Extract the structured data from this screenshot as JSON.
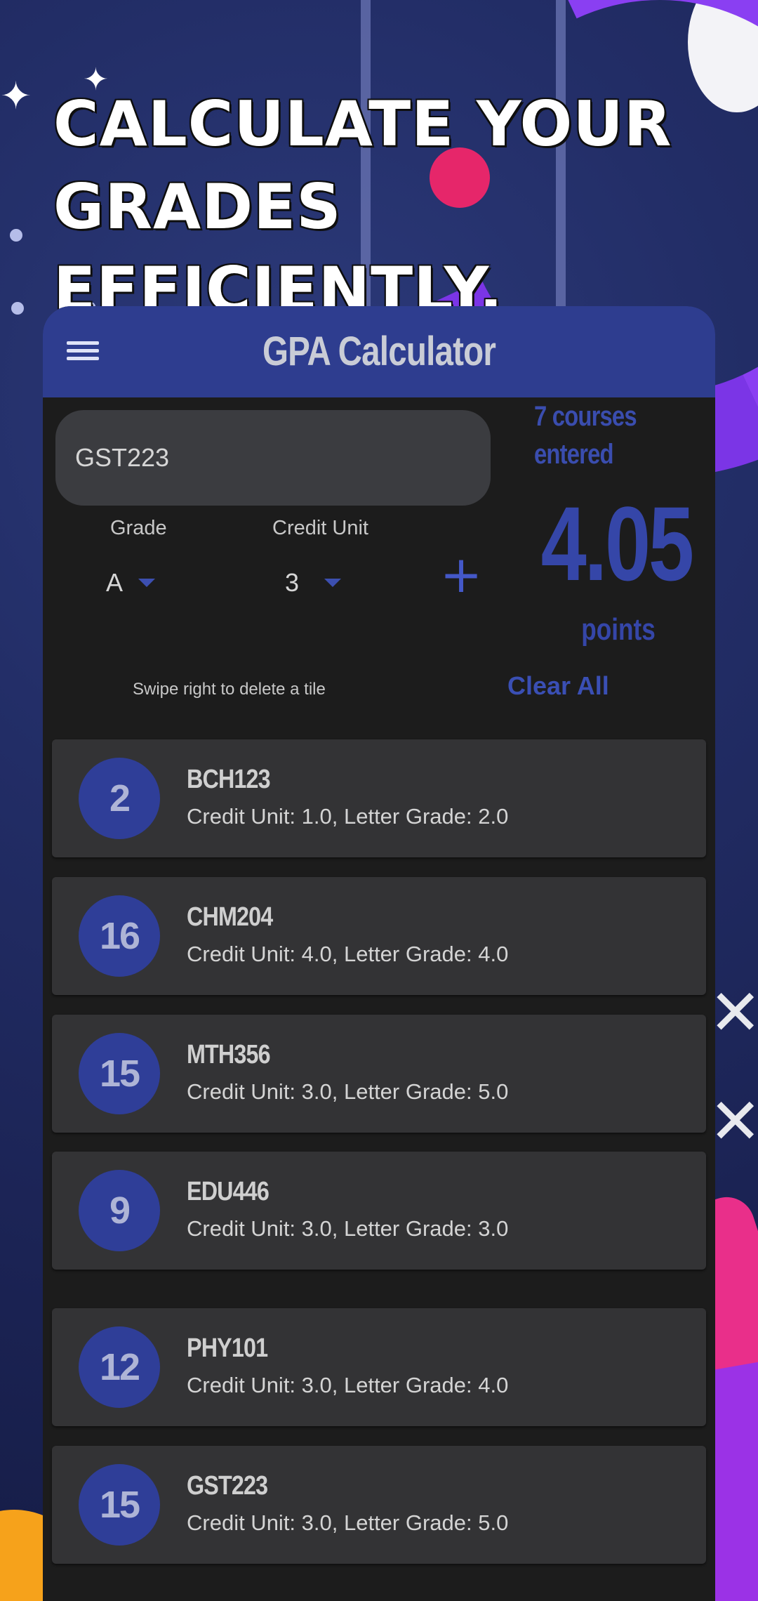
{
  "headline": "Calculate your grades efficiently.",
  "app": {
    "title": "GPA Calculator",
    "course_input_value": "GST223",
    "grade_label": "Grade",
    "credit_label": "Credit Unit",
    "grade_value": "A",
    "credit_value": "3",
    "add_icon": "+",
    "courses_entered": "7 courses entered",
    "gpa": "4.05",
    "points_label": "points",
    "hint": "Swipe right to delete a tile",
    "clear_all": "Clear All"
  },
  "courses": [
    {
      "score": "2",
      "code": "BCH123",
      "detail": "Credit Unit: 1.0, Letter Grade: 2.0"
    },
    {
      "score": "16",
      "code": "CHM204",
      "detail": "Credit Unit: 4.0, Letter Grade: 4.0"
    },
    {
      "score": "15",
      "code": "MTH356",
      "detail": "Credit Unit: 3.0, Letter Grade: 5.0"
    },
    {
      "score": "9",
      "code": "EDU446",
      "detail": "Credit Unit: 3.0, Letter Grade: 3.0"
    },
    {
      "score": "12",
      "code": "PHY101",
      "detail": "Credit Unit: 3.0, Letter Grade: 4.0"
    },
    {
      "score": "15",
      "code": "GST223",
      "detail": "Credit Unit: 3.0, Letter Grade: 5.0"
    }
  ],
  "colors": {
    "accent": "#2e3d8f",
    "background": "#1c1c1c",
    "tile": "#333335"
  }
}
